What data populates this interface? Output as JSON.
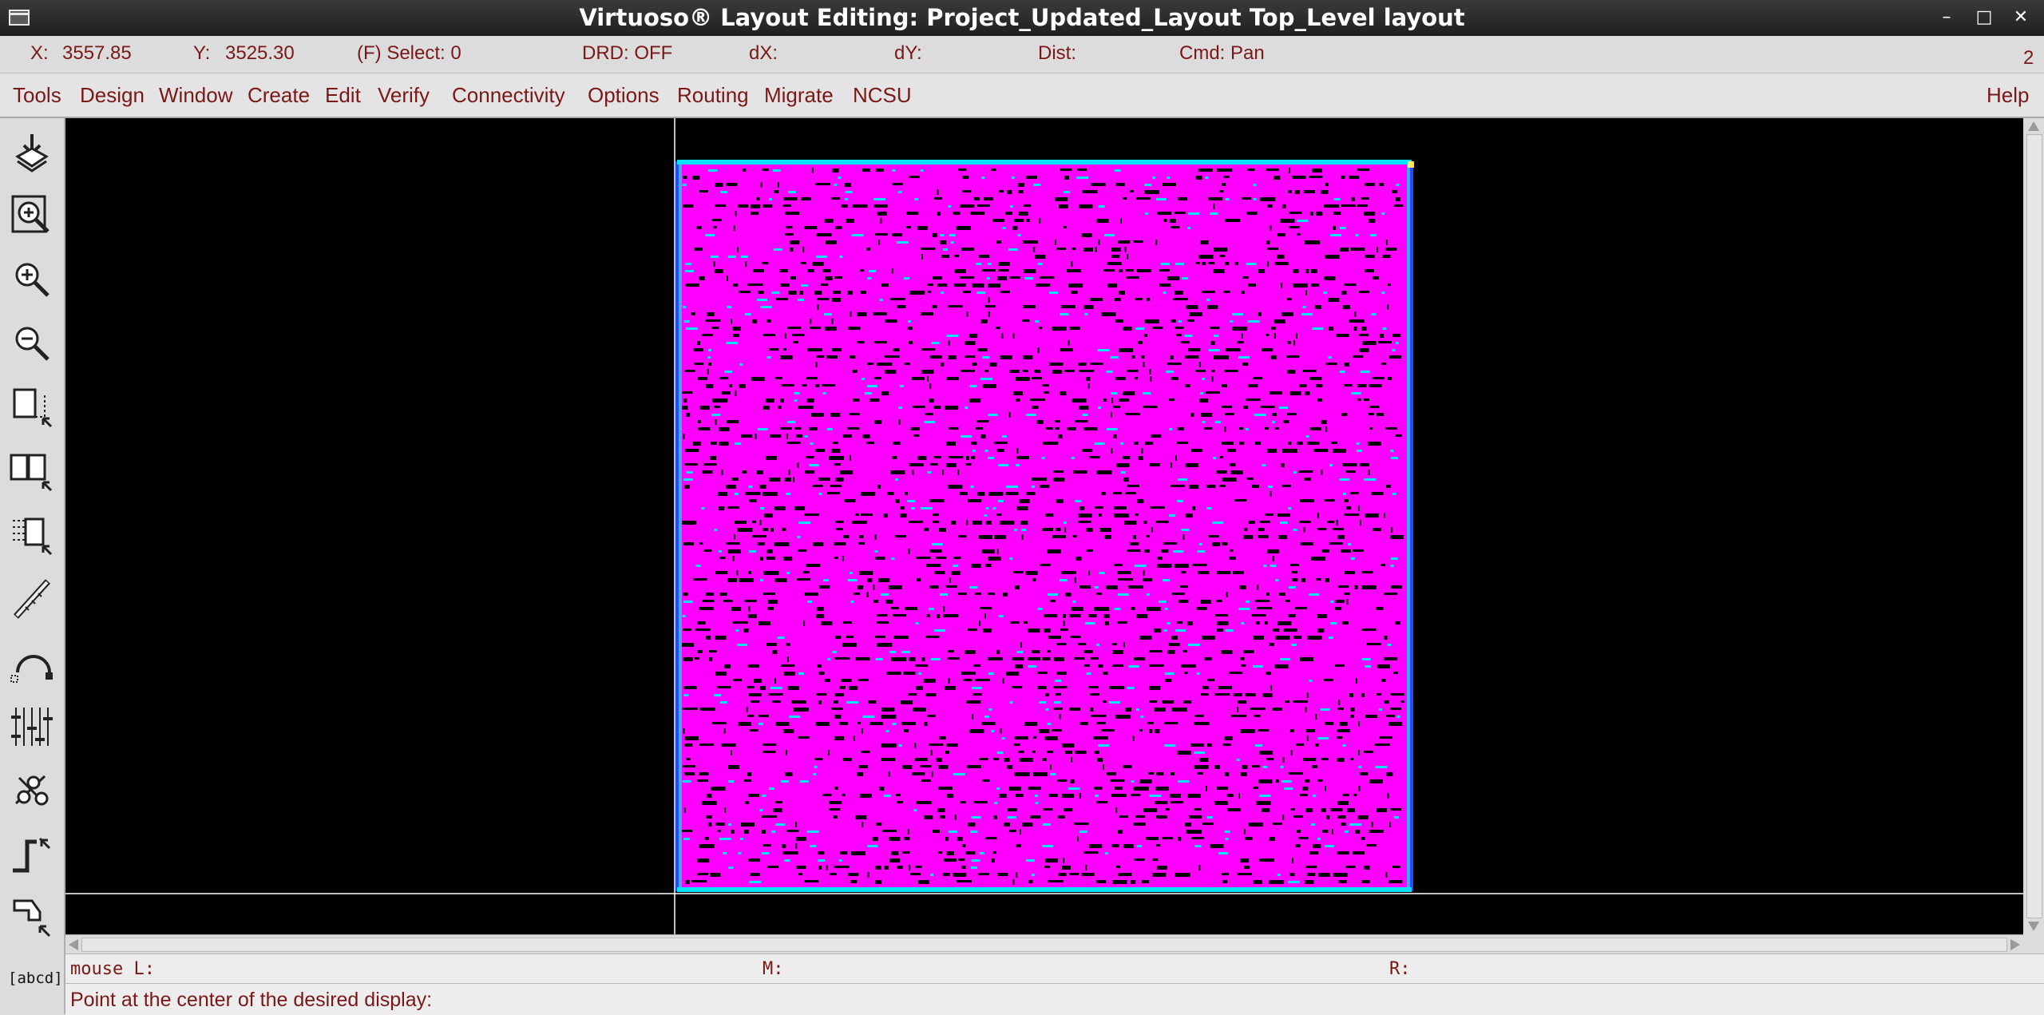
{
  "window": {
    "title": "Virtuoso® Layout Editing: Project_Updated_Layout Top_Level layout",
    "minimize_glyph": "–",
    "maximize_glyph": "□",
    "close_glyph": "✕"
  },
  "status": {
    "x_label": "X:",
    "x_value": "3557.85",
    "y_label": "Y:",
    "y_value": "3525.30",
    "select": "(F) Select: 0",
    "drd": "DRD: OFF",
    "dx": "dX:",
    "dy": "dY:",
    "dist": "Dist:",
    "cmd": "Cmd: Pan",
    "window_number": "2"
  },
  "menu": {
    "items": [
      "Tools",
      "Design",
      "Window",
      "Create",
      "Edit",
      "Verify",
      "Connectivity",
      "Options",
      "Routing",
      "Migrate",
      "NCSU"
    ],
    "help": "Help"
  },
  "toolbar": {
    "icons": [
      "save-icon",
      "zoom-fit-icon",
      "zoom-in-icon",
      "zoom-out-icon",
      "stretch-icon",
      "copy-icon",
      "move-icon",
      "ruler-icon",
      "undo-icon",
      "path-icon",
      "instance-icon",
      "wire-icon",
      "polygon-icon",
      "label-icon"
    ],
    "label_text": "[abcd]"
  },
  "colors": {
    "layout_fill": "#ff00ff",
    "metal_highlight": "#00e5ff",
    "boundary": "#1f4fff",
    "canvas_bg": "#000000",
    "text_dark_red": "#7a1818"
  },
  "mouse": {
    "left": "mouse L:",
    "middle": "M:",
    "right": "R:"
  },
  "prompt": "Point at the center of the desired display:"
}
